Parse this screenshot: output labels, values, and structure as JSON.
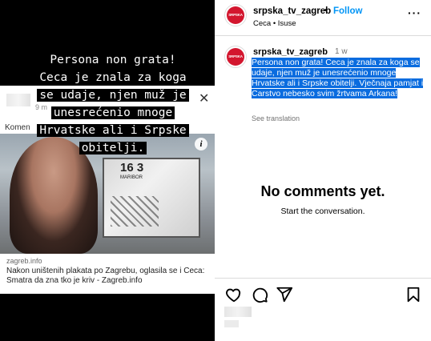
{
  "story": {
    "overlay_lines": [
      "Persona non grata!",
      "Ceca je znala za koga",
      "se udaje, njen muž je",
      "unesrećenio mnoge",
      "Hrvatske ali i Srpske",
      "obitelji."
    ],
    "card": {
      "time": "9 m",
      "comment_label": "Komen",
      "close_glyph": "✕",
      "domain": "zagreb.info",
      "title": "Nakon uništenih plakata po Zagrebu, oglasila se i Ceca: Smatra da zna tko je kriv - Zagreb.info",
      "billboard_number": "16 3",
      "billboard_sub": "MARIBOR",
      "info_glyph": "i"
    }
  },
  "post": {
    "avatar_text": "SRPSKA",
    "username": "srpska_tv_zagreb",
    "separator": "•",
    "follow_label": "Follow",
    "subtitle": "Ceca • Isuse",
    "more_glyph": "···",
    "caption": {
      "username": "srpska_tv_zagreb",
      "time": "1 w",
      "text": "Persona non grata! Ceca je znala za koga se udaje, njen muž je unesrećenio mnoge Hrvatske ali i Srpske obitelji. Vječnaja pamjat i Carstvo nebesko svim žrtvama Arkana!",
      "see_translation": "See translation"
    },
    "empty_title": "No comments yet.",
    "empty_subtitle": "Start the conversation.",
    "actions": [
      "heart-icon",
      "comment-icon",
      "share-icon",
      "bookmark-icon"
    ]
  },
  "colors": {
    "follow": "#0095f6",
    "selection": "#0a6cdf",
    "brand": "#d3162e"
  }
}
